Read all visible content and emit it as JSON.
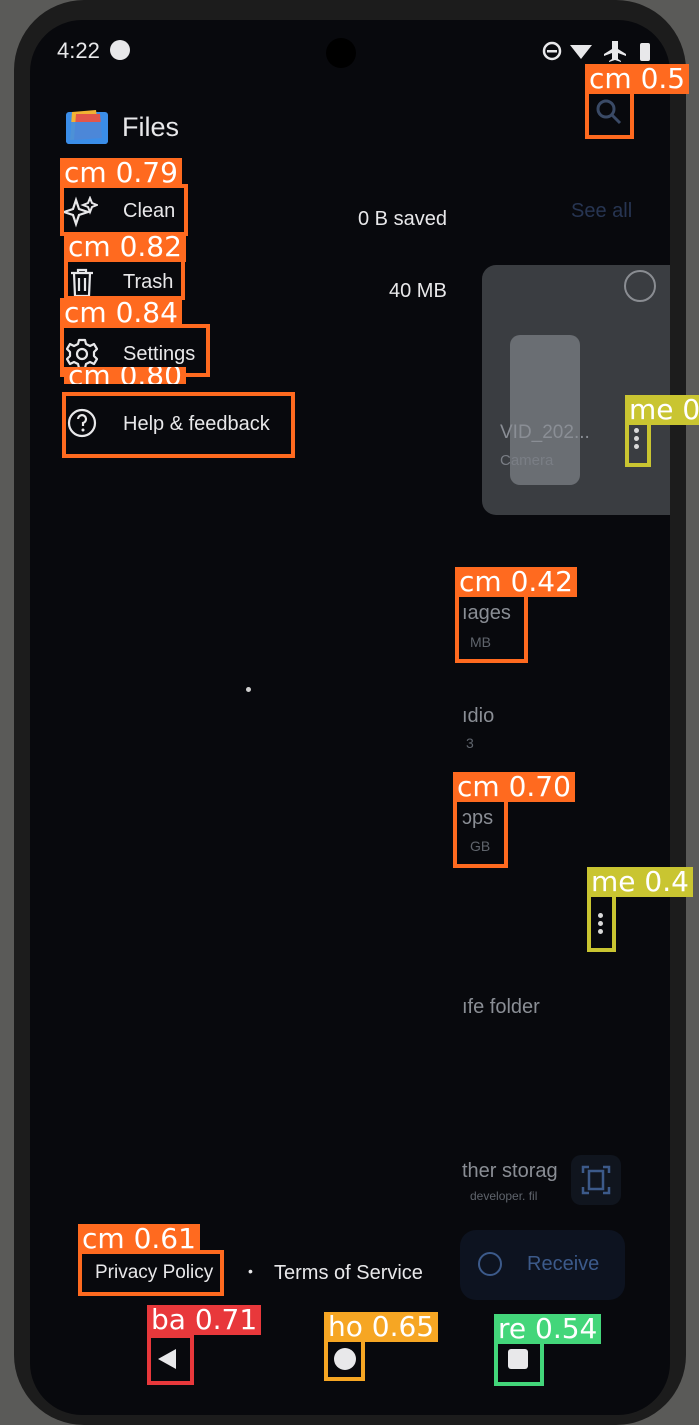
{
  "status_bar": {
    "time": "4:22"
  },
  "drawer": {
    "app_title": "Files",
    "items": [
      {
        "label": "Clean",
        "icon": "sparkle-icon"
      },
      {
        "label": "Trash",
        "icon": "trash-icon"
      },
      {
        "label": "Settings",
        "icon": "gear-icon"
      },
      {
        "label": "Help & feedback",
        "icon": "help-icon"
      }
    ],
    "footer": {
      "privacy": "Privacy Policy",
      "separator": "•",
      "terms": "Terms of Service"
    }
  },
  "background": {
    "see_all": "See all",
    "saved": "0 B saved",
    "trash_size": "40 MB",
    "video_name": "VID_202...",
    "video_source": "Camera",
    "images_label": "ıages",
    "images_sub": "MB",
    "audio_label": "ıdio",
    "audio_sub": "3",
    "apps_label": "ɔps",
    "apps_sub": "GB",
    "safe_folder": "ıfe folder",
    "other_storage": "ther storag",
    "other_sub": "developer. fil",
    "receive": "Receive"
  },
  "detections": {
    "search": "cm 0.5",
    "clean": "cm 0.79",
    "trash": "cm 0.82",
    "settings": "cm 0.84",
    "help": "cm 0.80",
    "menu_top": "me 0",
    "images": "cm 0.42",
    "apps": "cm 0.70",
    "menu_mid": "me 0.4",
    "privacy": "cm 0.61",
    "back": "ba 0.71",
    "home": "ho 0.65",
    "recents": "re 0.54"
  },
  "colors": {
    "accent": "#ff6a1f",
    "menu": "#c9c531",
    "back": "#e8383b",
    "home": "#f6a623",
    "recents": "#43d67a"
  }
}
